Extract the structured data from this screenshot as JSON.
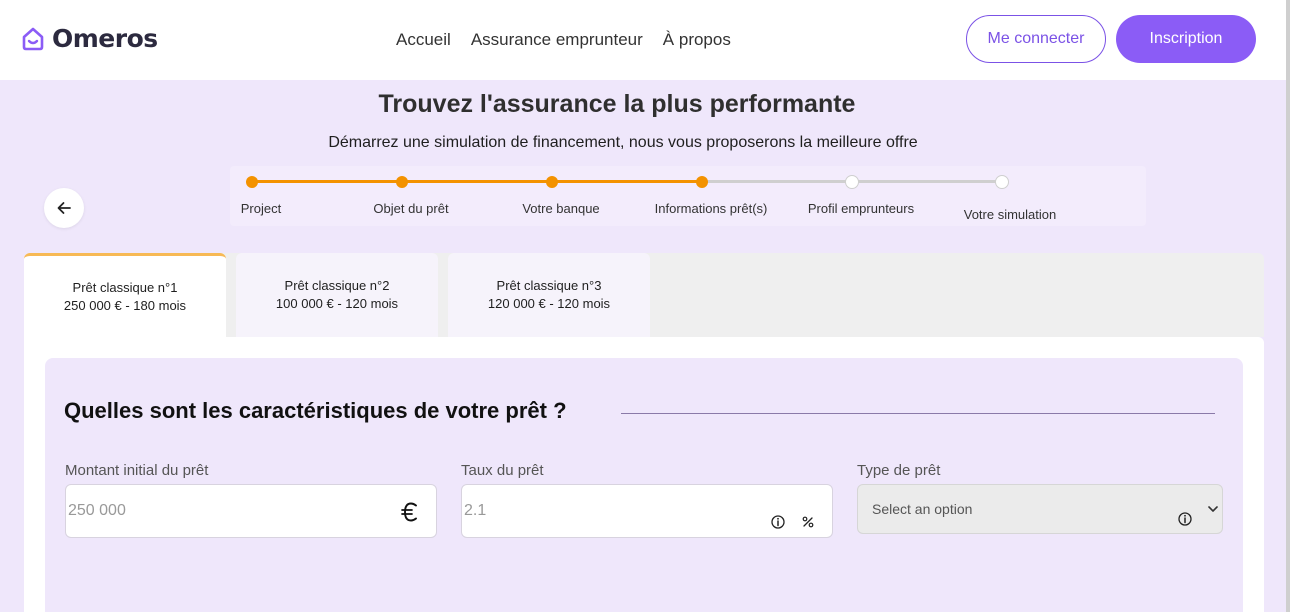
{
  "brand": {
    "name": "Omeros",
    "accent": "#8b5cf6",
    "progress_color": "#f39200"
  },
  "nav": {
    "items": [
      "Accueil",
      "Assurance emprunteur",
      "À propos"
    ]
  },
  "auth": {
    "login_label": "Me connecter",
    "signup_label": "Inscription"
  },
  "hero": {
    "title": "Trouvez l'assurance la plus performante",
    "subtitle": "Démarrez une simulation de financement, nous vous proposerons la meilleure offre"
  },
  "stepper": {
    "steps": [
      "Project",
      "Objet du prêt",
      "Votre banque",
      "Informations prêt(s)",
      "Profil emprunteurs",
      "Votre simulation"
    ],
    "completed_count": 4
  },
  "tabs": [
    {
      "label": "Prêt classique n°1",
      "detail": "250 000 € - 180 mois",
      "active": true
    },
    {
      "label": "Prêt classique n°2",
      "detail": "100 000 € - 120 mois",
      "active": false
    },
    {
      "label": "Prêt classique n°3",
      "detail": "120 000 € - 120 mois",
      "active": false
    }
  ],
  "form": {
    "section_title": "Quelles sont les caractéristiques de votre prêt ?",
    "amount": {
      "label": "Montant initial du prêt",
      "value": "250 000",
      "unit_icon": "euro-icon"
    },
    "rate": {
      "label": "Taux du prêt",
      "value": "2.1",
      "unit_icon": "percent-icon"
    },
    "type": {
      "label": "Type de prêt",
      "placeholder": "Select an option"
    }
  }
}
